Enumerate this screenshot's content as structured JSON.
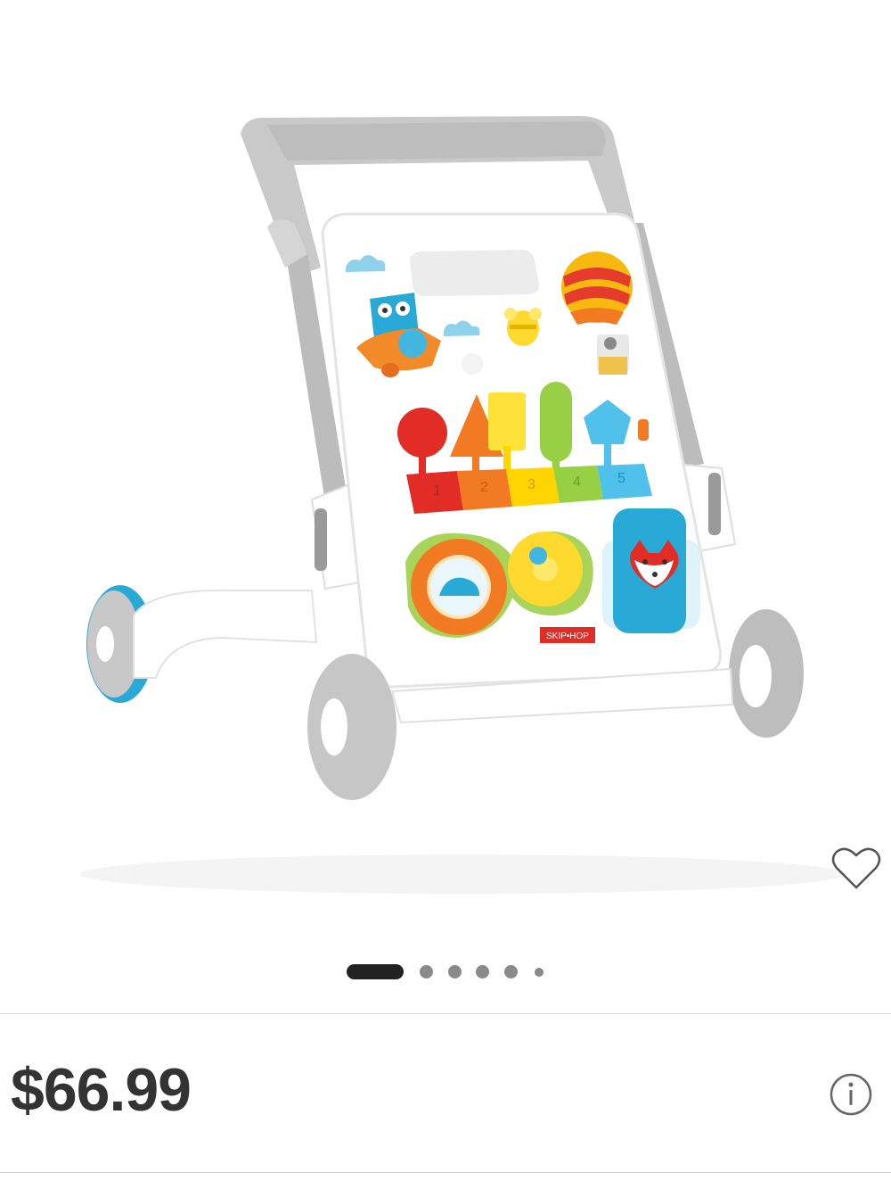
{
  "product": {
    "image_description_icon": "baby-activity-walker-image",
    "price": "$66.99",
    "brand_mark": "SKIP•HOP",
    "keys": [
      "1",
      "2",
      "3",
      "4",
      "5"
    ]
  },
  "carousel": {
    "total_dots": 6,
    "active_index": 0
  },
  "icons": {
    "favorite": "heart-outline-icon",
    "info": "info-circle-icon"
  },
  "colors": {
    "price_text": "#333333",
    "active_dot": "#222222",
    "inactive_dot": "#8a8a8a",
    "divider": "#d6d6d6",
    "accent_blue": "#29a9d6"
  }
}
